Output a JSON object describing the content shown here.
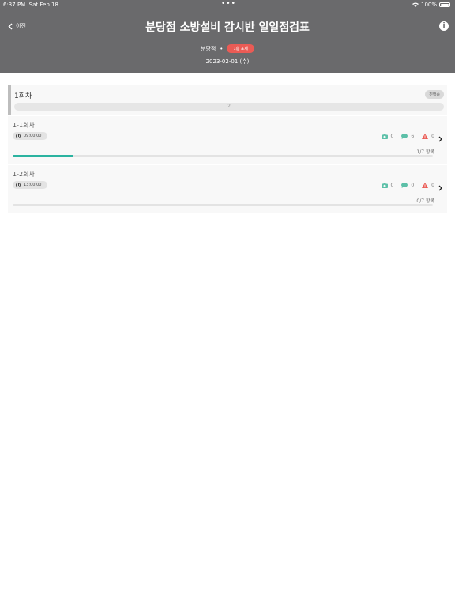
{
  "status_bar": {
    "time": "6:37 PM",
    "date": "Sat Feb 18",
    "battery": "100%"
  },
  "header": {
    "back_label": "이전",
    "title": "분당점 소방설비 감시반 일일점검표",
    "branch": "분당점",
    "separator": "•",
    "status_pill": "1층 표제",
    "date": "2023-02-01 (수)"
  },
  "round": {
    "title": "1회차",
    "badge": "진행중",
    "progress_text": "2"
  },
  "sub_rounds": [
    {
      "title": "1-1회차",
      "time": "09:00:00",
      "photo_count": "0",
      "comment_count": "6",
      "warning_count": "0",
      "item_count": "1/7 항목",
      "progress": 0.143
    },
    {
      "title": "1-2회차",
      "time": "13:00:00",
      "photo_count": "0",
      "comment_count": "0",
      "warning_count": "0",
      "item_count": "0/7 항목",
      "progress": 0
    }
  ],
  "colors": {
    "header_bg": "#6a6a6c",
    "accent": "#2bb3a0",
    "status_pill": "#ea5b55",
    "warning": "#ea5b55"
  }
}
